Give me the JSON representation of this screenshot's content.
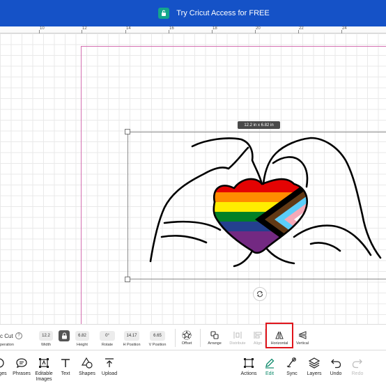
{
  "promo": {
    "text": "Try Cricut Access for FREE"
  },
  "ruler": {
    "ticks": [
      "10",
      "12",
      "14",
      "16",
      "18",
      "20",
      "22",
      "24"
    ]
  },
  "canvas": {
    "size_label": "12.2 in x 6.82 in"
  },
  "colors": {
    "promo_bg": "#1552c7",
    "promo_icon": "#14a58c",
    "mat_edge": "#d46fb0",
    "highlight": "#e0141b",
    "active": "#0e8a6b",
    "rainbow": [
      "#e40303",
      "#ff8c00",
      "#ffed00",
      "#008026",
      "#24408e",
      "#732982"
    ],
    "chevron": [
      "#ffffff",
      "#f5a9b8",
      "#5bcefa",
      "#613915",
      "#000000"
    ]
  },
  "edit_toolbar": {
    "operation": {
      "value": "c Cut",
      "label": "peration"
    },
    "fields": {
      "width": {
        "value": "12.2",
        "label": "Width"
      },
      "height": {
        "value": "6.82",
        "label": "Height"
      },
      "rotate": {
        "value": "0°",
        "label": "Rotate"
      },
      "h_position": {
        "value": "14.17",
        "label": "H Position"
      },
      "v_position": {
        "value": "6.65",
        "label": "V Position"
      }
    },
    "tools": {
      "offset": "Offset",
      "arrange": "Arrange",
      "distribute": "Distribute",
      "align": "Align",
      "flip_horizontal": "Horizontal",
      "flip_vertical": "Vertical"
    }
  },
  "bottom_nav": {
    "left": [
      "ages",
      "Phrases",
      "Editable Images",
      "Text",
      "Shapes",
      "Upload"
    ],
    "right": [
      "Actions",
      "Edit",
      "Sync",
      "Layers",
      "Undo",
      "Redo"
    ]
  }
}
